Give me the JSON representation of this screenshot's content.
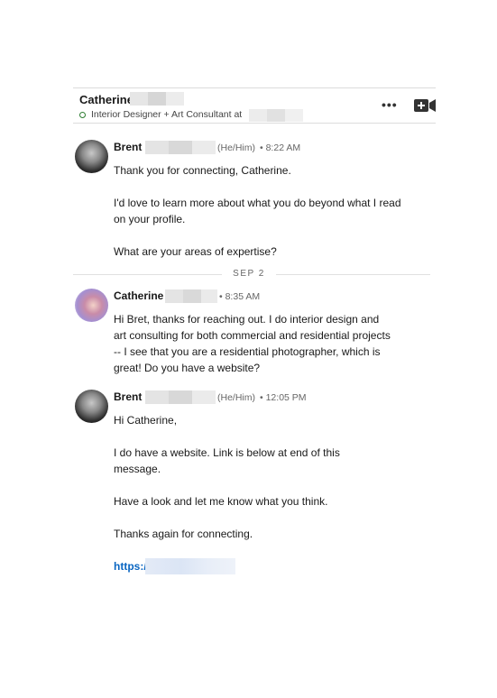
{
  "conversation": {
    "contact_name": "Catherine",
    "contact_headline": "Interior Designer + Art Consultant at",
    "more_label": "•••",
    "date_divider": "SEP 2"
  },
  "messages": [
    {
      "sender": "Brent",
      "pronouns": "(He/Him)",
      "time": "• 8:22 AM",
      "lines": [
        "Thank you for connecting, Catherine.",
        "I'd love to learn more about what you do beyond what I read on your profile.",
        "What are your areas of expertise?"
      ]
    },
    {
      "sender": "Catherine",
      "pronouns": "",
      "time": "• 8:35 AM",
      "lines": [
        "Hi Bret, thanks for reaching out. I do interior design and art consulting for both commercial and residential projects -- I see that you are a residential photographer, which is great! Do you have a website?"
      ]
    },
    {
      "sender": "Brent",
      "pronouns": "(He/Him)",
      "time": "• 12:05 PM",
      "lines": [
        "Hi Catherine,",
        "I do have a website. Link is below at end of this message.",
        "Have a look and let me know what you think.",
        "Thanks again for connecting."
      ],
      "link": "https:/"
    }
  ],
  "colors": {
    "link": "#0a66c2",
    "online_status": "#2e7d32"
  },
  "icons": [
    "more-icon",
    "video-add-icon",
    "online-status-icon"
  ]
}
